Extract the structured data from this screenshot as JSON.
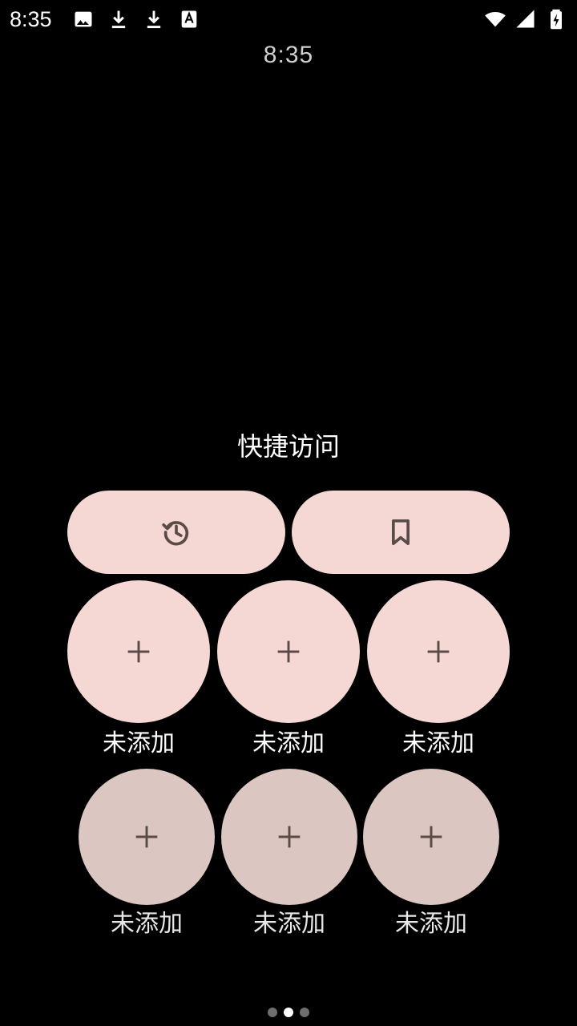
{
  "status_bar": {
    "time": "8:35",
    "left_icons": [
      "image-icon",
      "download-icon",
      "download-icon",
      "text-notification-icon"
    ],
    "right_icons": [
      "wifi-icon",
      "cellular-signal-icon",
      "battery-charging-icon"
    ]
  },
  "top_clock": "8:35",
  "quick_access": {
    "title": "快捷访问",
    "pills": [
      {
        "name": "history",
        "icon": "history-icon"
      },
      {
        "name": "bookmark",
        "icon": "bookmark-icon"
      }
    ],
    "slots_row1": [
      {
        "label": "未添加",
        "icon": "plus-icon"
      },
      {
        "label": "未添加",
        "icon": "plus-icon"
      },
      {
        "label": "未添加",
        "icon": "plus-icon"
      }
    ],
    "slots_row2": [
      {
        "label": "未添加",
        "icon": "plus-icon"
      },
      {
        "label": "未添加",
        "icon": "plus-icon"
      },
      {
        "label": "未添加",
        "icon": "plus-icon"
      }
    ]
  },
  "pager": {
    "count": 3,
    "active_index": 1
  },
  "colors": {
    "background": "#000000",
    "pill_bg": "#f5d8d3",
    "row2_bg": "#dcc6c1",
    "icon_color": "#5a4a48"
  }
}
